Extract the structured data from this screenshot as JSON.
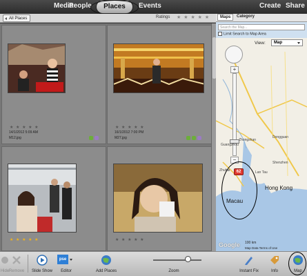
{
  "nav": {
    "tabs": [
      "Media",
      "People",
      "Places",
      "Events"
    ],
    "active": "Places",
    "right": [
      "Create",
      "Share"
    ]
  },
  "filter": {
    "all_places": "All Places",
    "ratings_label": "Ratings",
    "stars": "★ ★ ★ ★ ★"
  },
  "photos": [
    {
      "stars": "★ ★ ★ ★ ★",
      "date": "14/1/2012 5:09 AM",
      "file": "M12.jpg"
    },
    {
      "stars": "★ ★ ★ ★ ★",
      "date": "16/1/2012 7:00 PM",
      "file": "M27.jpg"
    },
    {
      "stars": "★ ★ ★ ★ ★",
      "date": "",
      "file": ""
    },
    {
      "stars": "★ ★ ★ ★ ★",
      "date": "",
      "file": ""
    }
  ],
  "map": {
    "tabs": [
      "Maps",
      "Category"
    ],
    "search_placeholder": "Search the Map...",
    "limit_label": "Limit Search to Map Area",
    "view_label": "View:",
    "view_value": "Map",
    "pin_count": "62",
    "labels": {
      "macau": "Macau",
      "hong_kong": "Hong Kong",
      "zhongshan": "Zhongshan",
      "dongguan": "Dongguan",
      "shenzhen": "Shenzhen",
      "zhuhai": "Zhuhai",
      "lantau": "Lan Tau",
      "guangzhou": "Guangzhou"
    },
    "scale": "100 km",
    "scale_mi": "50 mi",
    "footer": "Map Data   Terms of Use",
    "google": "Google"
  },
  "toolbar": {
    "hide": "Hide",
    "remove": "Remove",
    "slideshow": "Slide Show",
    "editor": "Editor",
    "editor_badge": "pse",
    "add_places": "Add Places",
    "zoom": "Zoom",
    "instant_fix": "Instant Fix",
    "info": "Info",
    "map": "Map"
  },
  "colors": {
    "pin": "#e03a2f",
    "star_gold": "#f1b31c",
    "accent": "#2e6fb5"
  }
}
